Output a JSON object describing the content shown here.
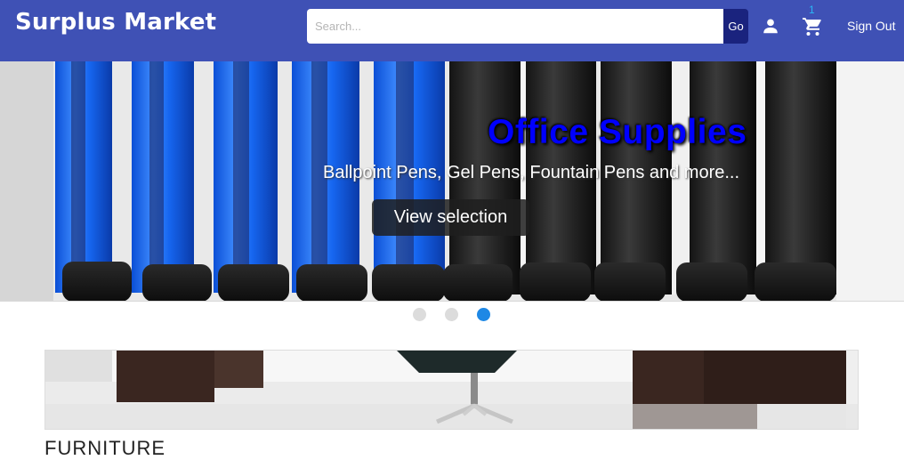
{
  "header": {
    "brand": "Surplus Market",
    "search_placeholder": "Search...",
    "go_label": "Go",
    "cart_count": "1",
    "signout_label": "Sign Out",
    "bg_color": "#3f51b5"
  },
  "carousel": {
    "title": "Office Supplies",
    "subtitle": "Ballpoint Pens, Gel Pens, Fountain Pens and more...",
    "button_label": "View selection",
    "slide_count": 3,
    "active_slide": 3
  },
  "category": {
    "label": "FURNITURE"
  },
  "icons": [
    "person-icon",
    "shopping-cart-icon"
  ]
}
